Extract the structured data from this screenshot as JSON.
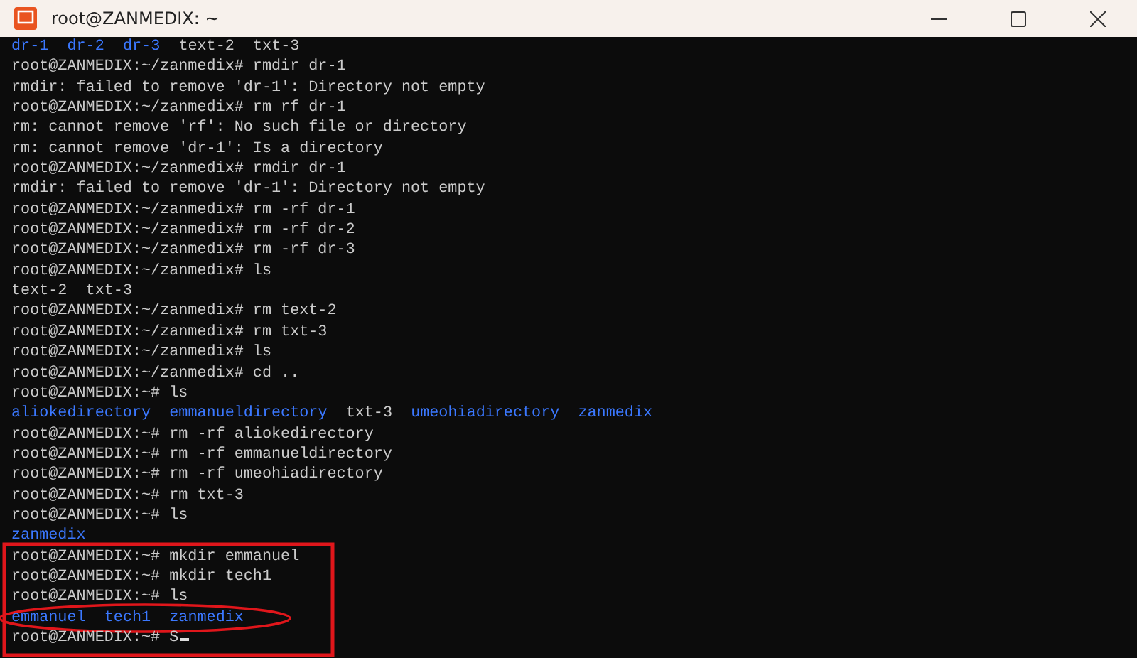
{
  "window": {
    "title": "root@ZANMEDIX: ~"
  },
  "lines": [
    {
      "kind": "listing",
      "items": [
        {
          "name": "dr-1",
          "color": "#3b78ff"
        },
        {
          "name": "dr-2",
          "color": "#3b78ff"
        },
        {
          "name": "dr-3",
          "color": "#3b78ff"
        },
        {
          "name": "text-2",
          "color": "#cccccc"
        },
        {
          "name": "txt-3",
          "color": "#cccccc"
        }
      ]
    },
    {
      "kind": "text",
      "text": "root@ZANMEDIX:~/zanmedix# rmdir dr-1"
    },
    {
      "kind": "text",
      "text": "rmdir: failed to remove 'dr-1': Directory not empty"
    },
    {
      "kind": "text",
      "text": "root@ZANMEDIX:~/zanmedix# rm rf dr-1"
    },
    {
      "kind": "text",
      "text": "rm: cannot remove 'rf': No such file or directory"
    },
    {
      "kind": "text",
      "text": "rm: cannot remove 'dr-1': Is a directory"
    },
    {
      "kind": "text",
      "text": "root@ZANMEDIX:~/zanmedix# rmdir dr-1"
    },
    {
      "kind": "text",
      "text": "rmdir: failed to remove 'dr-1': Directory not empty"
    },
    {
      "kind": "text",
      "text": "root@ZANMEDIX:~/zanmedix# rm -rf dr-1"
    },
    {
      "kind": "text",
      "text": "root@ZANMEDIX:~/zanmedix# rm -rf dr-2"
    },
    {
      "kind": "text",
      "text": "root@ZANMEDIX:~/zanmedix# rm -rf dr-3"
    },
    {
      "kind": "text",
      "text": "root@ZANMEDIX:~/zanmedix# ls"
    },
    {
      "kind": "listing",
      "items": [
        {
          "name": "text-2",
          "color": "#cccccc"
        },
        {
          "name": "txt-3",
          "color": "#cccccc"
        }
      ]
    },
    {
      "kind": "text",
      "text": "root@ZANMEDIX:~/zanmedix# rm text-2"
    },
    {
      "kind": "text",
      "text": "root@ZANMEDIX:~/zanmedix# rm txt-3"
    },
    {
      "kind": "text",
      "text": "root@ZANMEDIX:~/zanmedix# ls"
    },
    {
      "kind": "text",
      "text": "root@ZANMEDIX:~/zanmedix# cd .."
    },
    {
      "kind": "text",
      "text": "root@ZANMEDIX:~# ls"
    },
    {
      "kind": "listing",
      "items": [
        {
          "name": "aliokedirectory",
          "color": "#3b78ff"
        },
        {
          "name": "emmanueldirectory",
          "color": "#3b78ff"
        },
        {
          "name": "txt-3",
          "color": "#cccccc"
        },
        {
          "name": "umeohiadirectory",
          "color": "#3b78ff"
        },
        {
          "name": "zanmedix",
          "color": "#3b78ff"
        }
      ]
    },
    {
      "kind": "text",
      "text": "root@ZANMEDIX:~# rm -rf aliokedirectory"
    },
    {
      "kind": "text",
      "text": "root@ZANMEDIX:~# rm -rf emmanueldirectory"
    },
    {
      "kind": "text",
      "text": "root@ZANMEDIX:~# rm -rf umeohiadirectory"
    },
    {
      "kind": "text",
      "text": "root@ZANMEDIX:~# rm txt-3"
    },
    {
      "kind": "text",
      "text": "root@ZANMEDIX:~# ls"
    },
    {
      "kind": "listing",
      "items": [
        {
          "name": "zanmedix",
          "color": "#3b78ff"
        }
      ]
    },
    {
      "kind": "text",
      "text": "root@ZANMEDIX:~# mkdir emmanuel"
    },
    {
      "kind": "text",
      "text": "root@ZANMEDIX:~# mkdir tech1"
    },
    {
      "kind": "text",
      "text": "root@ZANMEDIX:~# ls"
    },
    {
      "kind": "listing",
      "items": [
        {
          "name": "emmanuel",
          "color": "#3b78ff"
        },
        {
          "name": "tech1",
          "color": "#3b78ff"
        },
        {
          "name": "zanmedix",
          "color": "#3b78ff"
        }
      ]
    },
    {
      "kind": "prompt",
      "text": "root@ZANMEDIX:~# S"
    }
  ],
  "annotations": [
    {
      "kind": "rectangle"
    },
    {
      "kind": "ellipse"
    }
  ]
}
